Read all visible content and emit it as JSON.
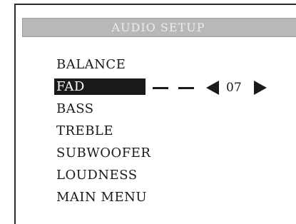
{
  "header": {
    "title": "AUDIO SETUP"
  },
  "menu": {
    "items": [
      {
        "label": "BALANCE"
      },
      {
        "label": "FAD"
      },
      {
        "label": "BASS"
      },
      {
        "label": "TREBLE"
      },
      {
        "label": "SUBWOOFER"
      },
      {
        "label": "LOUDNESS"
      },
      {
        "label": "MAIN MENU"
      }
    ],
    "selected_label": "FAD"
  },
  "adjust": {
    "value": "07",
    "left_icon": "triangle-left-icon",
    "right_icon": "triangle-right-icon"
  },
  "colors": {
    "title_bar_bg": "#b8b8b8",
    "title_text": "#ececec",
    "highlight_bg": "#1a1a1a",
    "highlight_text": "#ffffff",
    "text": "#1a1a1a"
  }
}
